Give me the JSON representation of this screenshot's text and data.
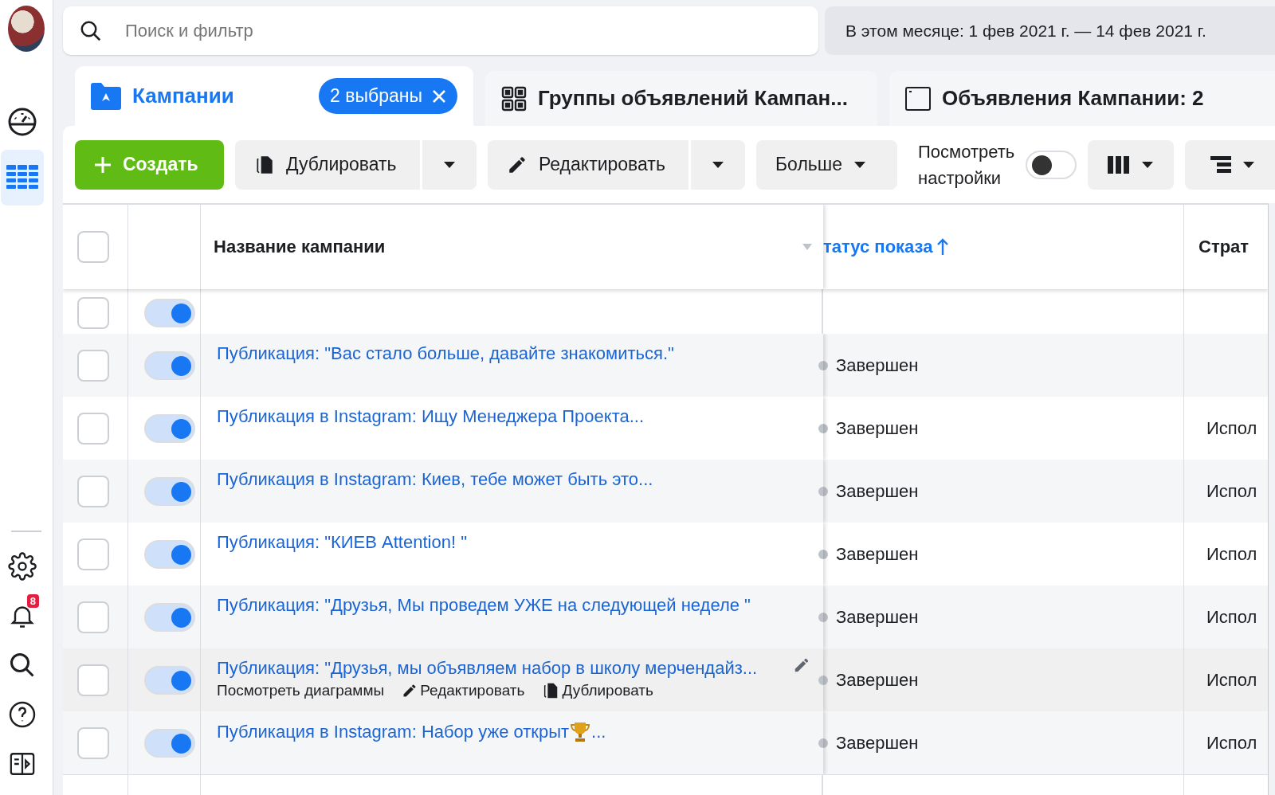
{
  "sidebar": {
    "items": [
      {
        "kind": "avatar"
      },
      {
        "kind": "dashboard",
        "selected": false
      },
      {
        "kind": "table",
        "selected": true
      },
      {
        "kind": "divider"
      },
      {
        "kind": "settings",
        "selected": false
      },
      {
        "kind": "bell",
        "selected": false,
        "badge": "8"
      },
      {
        "kind": "search",
        "selected": false
      },
      {
        "kind": "help",
        "selected": false
      },
      {
        "kind": "panel",
        "selected": false
      }
    ]
  },
  "search": {
    "placeholder": "Поиск и фильтр"
  },
  "date_range": "В этом месяце: 1 фев 2021 г. — 14 фев 2021 г.",
  "tabs": [
    {
      "kind": "campaigns",
      "label": "Кампании",
      "selected": true,
      "chip": "2 выбраны"
    },
    {
      "kind": "adsets",
      "label": "Группы объявлений Кампан...",
      "selected": false
    },
    {
      "kind": "ads",
      "label": "Объявления Кампании: 2",
      "selected": false
    }
  ],
  "toolbar": {
    "create": "Создать",
    "duplicate": "Дублировать",
    "edit": "Редактировать",
    "more": "Больше",
    "view_settings": {
      "label": "Посмотреть настройки",
      "on": false
    }
  },
  "table": {
    "columns": [
      {
        "kind": "check",
        "checked": false
      },
      {
        "kind": "toggle"
      },
      {
        "kind": "name",
        "label": "Название кампании",
        "sorted": false
      },
      {
        "kind": "status",
        "label": "татус показа",
        "sorted": true
      },
      {
        "kind": "strategy",
        "label": "Страт"
      }
    ],
    "rows": [
      {
        "kind": "partial",
        "checked": false,
        "on": true,
        "hovered": false
      },
      {
        "kind": "full",
        "checked": false,
        "on": true,
        "hovered": false,
        "name": "Публикация: \"Вас стало больше, давайте знакомиться.\"",
        "status": "Завершен"
      },
      {
        "kind": "full",
        "checked": false,
        "on": true,
        "hovered": false,
        "name": "Публикация в Instagram: Ищу Менеджера Проекта...",
        "status": "Завершен",
        "strategy": "Испол"
      },
      {
        "kind": "full",
        "checked": false,
        "on": true,
        "hovered": false,
        "name": "Публикация в Instagram: Киев, тебе может быть это...",
        "status": "Завершен",
        "strategy": "Испол"
      },
      {
        "kind": "full",
        "checked": false,
        "on": true,
        "hovered": false,
        "name": "Публикация: \"КИЕВ Attention! \"",
        "status": "Завершен",
        "strategy": "Испол"
      },
      {
        "kind": "full",
        "checked": false,
        "on": true,
        "hovered": false,
        "name": "Публикация: \"Друзья, Мы проведем УЖЕ на следующей неделе \"",
        "status": "Завершен",
        "strategy": "Испол"
      },
      {
        "kind": "full",
        "checked": false,
        "on": true,
        "hovered": true,
        "name": "Публикация: \"Друзья, мы объявляем набор в школу мерчендайз...",
        "status": "Завершен",
        "strategy": "Испол",
        "actions": [
          "Посмотреть диаграммы",
          "Редактировать",
          "Дублировать"
        ]
      },
      {
        "kind": "full",
        "checked": false,
        "on": true,
        "hovered": false,
        "name": "Публикация в Instagram: Набор уже открыт",
        "trophy": true,
        "name_tail": " ...",
        "status": "Завершен",
        "strategy": "Испол"
      }
    ]
  }
}
